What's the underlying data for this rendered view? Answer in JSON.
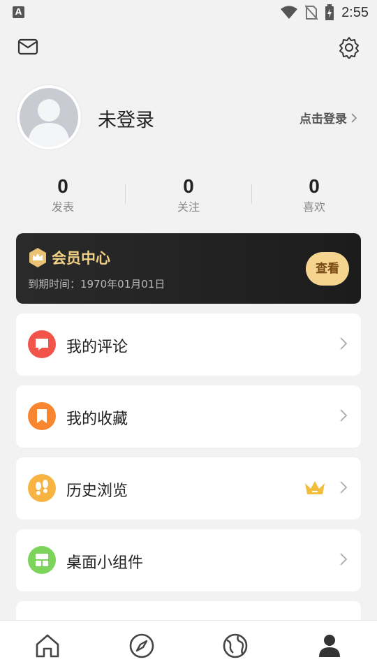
{
  "status_bar": {
    "time": "2:55",
    "app_icon_letter": "A"
  },
  "header": {
    "mail_icon": "mail-icon",
    "settings_icon": "gear-icon"
  },
  "profile": {
    "username": "未登录",
    "login_link": "点击登录"
  },
  "stats": [
    {
      "value": "0",
      "label": "发表"
    },
    {
      "value": "0",
      "label": "关注"
    },
    {
      "value": "0",
      "label": "喜欢"
    }
  ],
  "vip": {
    "title": "会员中心",
    "expire": "到期时间：1970年01月01日",
    "button": "查看",
    "accent": "#f1cf83"
  },
  "menu": [
    {
      "label": "我的评论",
      "icon": "comment-icon",
      "color": "#f2544a"
    },
    {
      "label": "我的收藏",
      "icon": "bookmark-icon",
      "color": "#f7862e"
    },
    {
      "label": "历史浏览",
      "icon": "footprint-icon",
      "color": "#f8b443"
    },
    {
      "label": "桌面小组件",
      "icon": "widget-icon",
      "color": "#7cd45a"
    }
  ],
  "tabbar": {
    "items": [
      "home-icon",
      "compass-icon",
      "globe-icon",
      "profile-icon"
    ],
    "active": "profile-icon"
  }
}
